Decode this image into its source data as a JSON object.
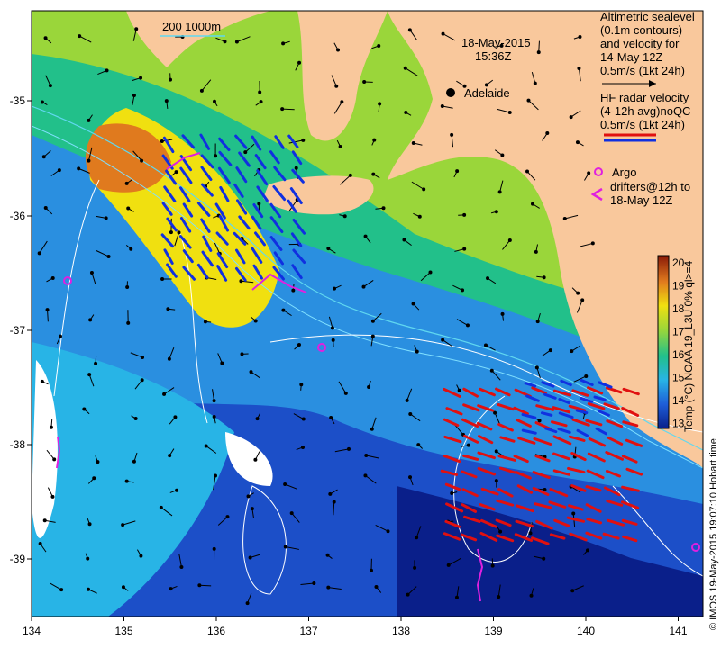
{
  "map": {
    "date": "18-May-2015",
    "time": "15:36Z",
    "city": "Adelaide",
    "depth_legend": "200  1000m",
    "legend_altimetry": [
      "Altimetric sealevel",
      "(0.1m contours)",
      "and velocity for",
      "14-May 12Z",
      "0.5m/s (1kt 24h)"
    ],
    "legend_hf": [
      "HF radar velocity",
      "(4-12h avg)noQC",
      "0.5m/s (1kt 24h)"
    ],
    "legend_argo": [
      "Argo",
      "drifters@12h to",
      "18-May 12Z"
    ],
    "colorbar_label": "Temp (°C) NOAA 19_L3U 0% ql>=4",
    "colorbar_ticks": [
      "20",
      "19",
      "18",
      "17",
      "16",
      "15",
      "14",
      "13"
    ],
    "credit": "© IMOS 19-May-2015 19:07:10 Hobart time",
    "x_ticks": [
      "134",
      "135",
      "136",
      "137",
      "138",
      "139",
      "140",
      "141"
    ],
    "y_ticks": [
      "-35",
      "-36",
      "-37",
      "-38",
      "-39"
    ],
    "colors": {
      "land": "#f9c89c",
      "sst_warm": "#e07a1e",
      "sst_mid": "#9ad63a",
      "sst_cool": "#2a8fe0",
      "sst_cold": "#0a1f8a",
      "hf_radar": [
        "#e01010",
        "#1030e0"
      ],
      "argo": "#e020e0"
    }
  }
}
